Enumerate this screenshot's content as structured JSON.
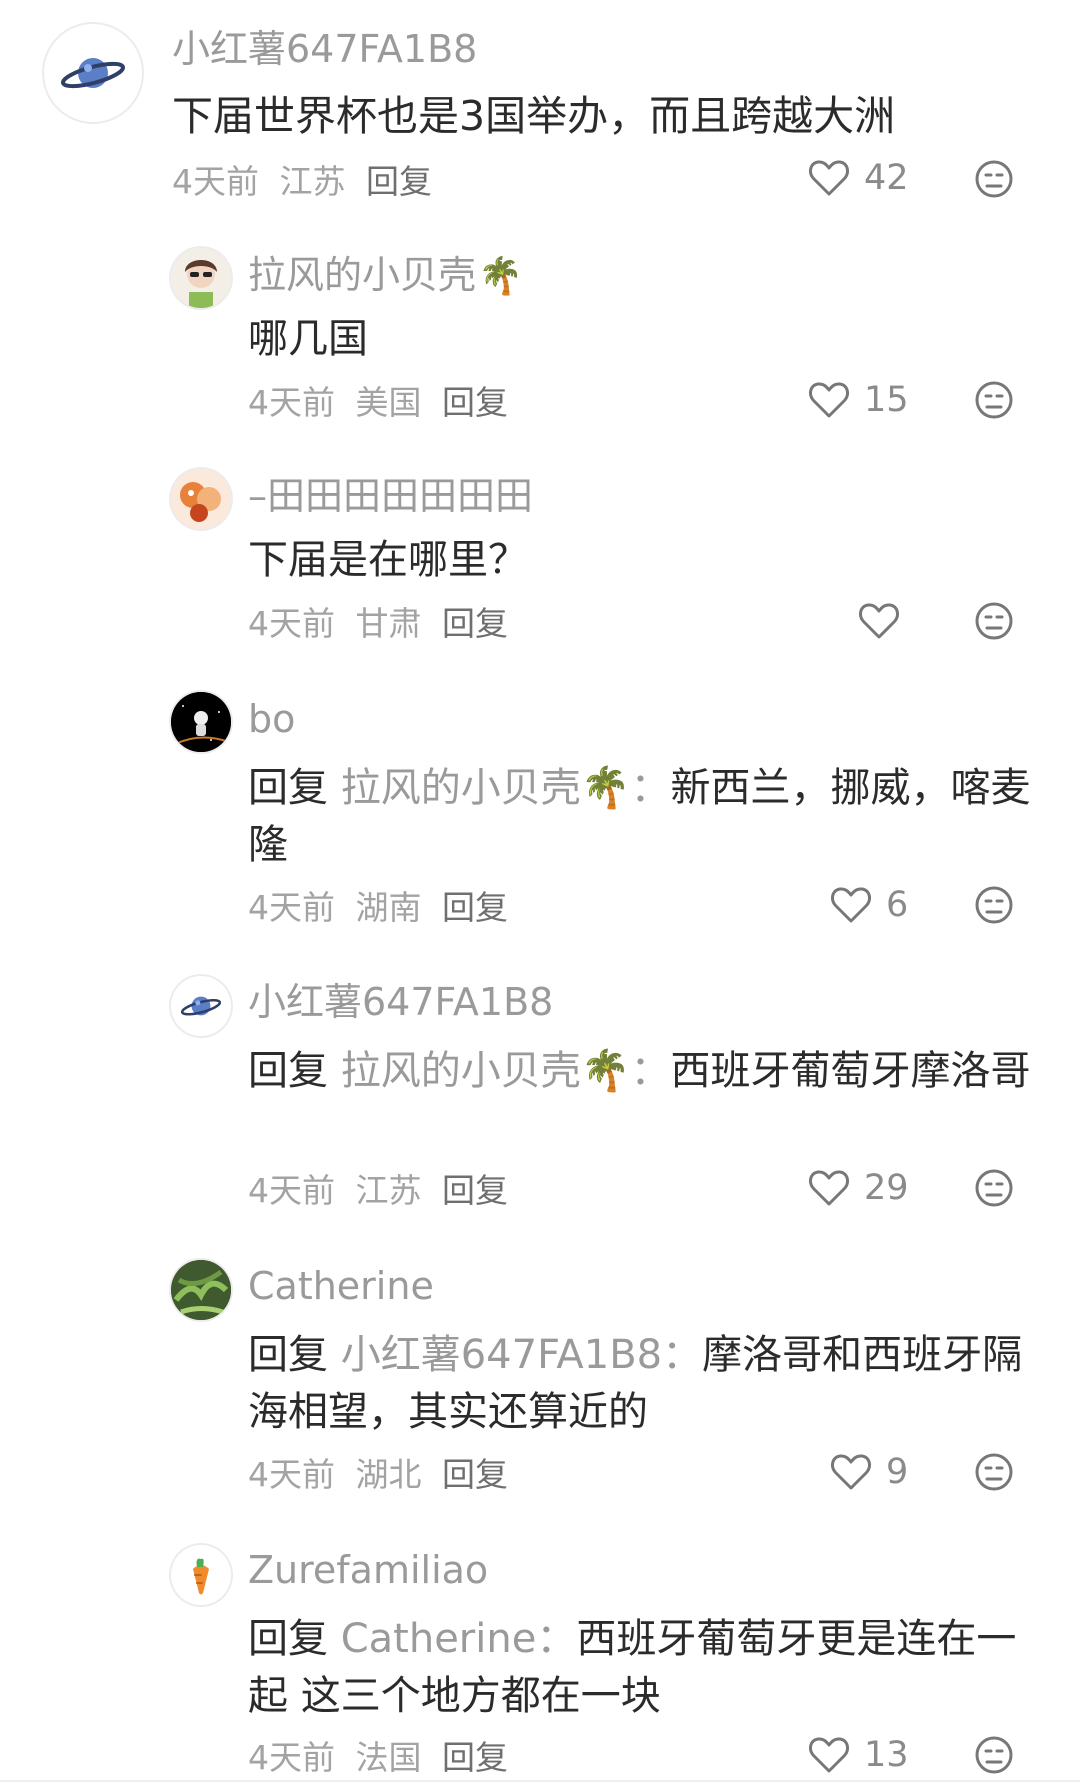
{
  "comments": [
    {
      "avatar": "planet-avatar",
      "name": "小红薯647FA1B8",
      "emoji": "",
      "lead": "",
      "target": "",
      "text": "下届世界杯也是3国举办，而且跨越大洲",
      "time": "4天前",
      "location": "江苏",
      "reply": "回复",
      "likes": "42"
    },
    {
      "avatar": "girl-avatar",
      "name": "拉风的小贝壳",
      "emoji": "🌴",
      "lead": "",
      "target": "",
      "text": "哪几国",
      "time": "4天前",
      "location": "美国",
      "reply": "回复",
      "likes": "15"
    },
    {
      "avatar": "cartoon-avatar",
      "name": "–田田田田田田田",
      "emoji": "",
      "lead": "",
      "target": "",
      "text": "下届是在哪里？",
      "time": "4天前",
      "location": "甘肃",
      "reply": "回复",
      "likes": ""
    },
    {
      "avatar": "astronaut-avatar",
      "name": "bo",
      "emoji": "",
      "lead": "回复 ",
      "target": "拉风的小贝壳🌴：",
      "text": "新西兰，挪威，喀麦隆",
      "time": "4天前",
      "location": "湖南",
      "reply": "回复",
      "likes": "6"
    },
    {
      "avatar": "planet-avatar",
      "name": "小红薯647FA1B8",
      "emoji": "",
      "lead": "回复 ",
      "target": "拉风的小贝壳🌴：",
      "text": "西班牙葡萄牙摩洛哥",
      "time": "4天前",
      "location": "江苏",
      "reply": "回复",
      "likes": "29"
    },
    {
      "avatar": "plant-avatar",
      "name": "Catherine",
      "emoji": "",
      "lead": "回复 ",
      "target": "小红薯647FA1B8：",
      "text": "摩洛哥和西班牙隔海相望，其实还算近的",
      "time": "4天前",
      "location": "湖北",
      "reply": "回复",
      "likes": "9"
    },
    {
      "avatar": "carrot-avatar",
      "name": "Zurefamiliao",
      "emoji": "",
      "lead": "回复 ",
      "target": "Catherine：",
      "text": "西班牙葡萄牙更是连在一起 这三个地方都在一块",
      "time": "4天前",
      "location": "法国",
      "reply": "回复",
      "likes": "13"
    }
  ],
  "colors": {
    "text": "#2b2b2b",
    "muted": "#9a9a9a",
    "icon": "#777777"
  }
}
